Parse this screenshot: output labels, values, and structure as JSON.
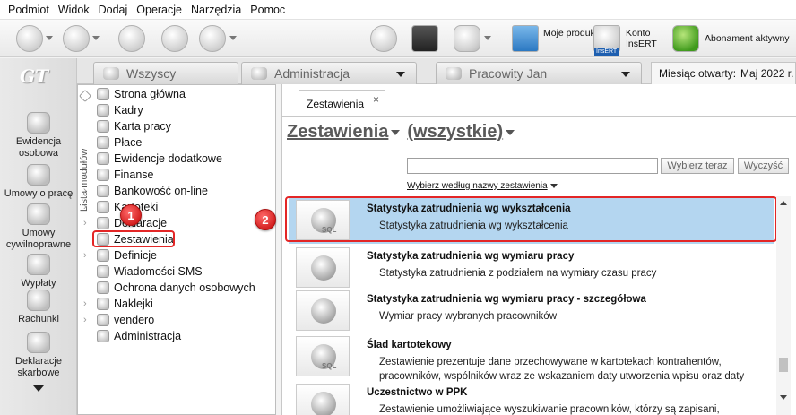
{
  "menu": [
    "Podmiot",
    "Widok",
    "Dodaj",
    "Operacje",
    "Narzędzia",
    "Pomoc"
  ],
  "toolbar": {
    "moje_produkty": "Moje produkty",
    "konto": "Konto InsERT",
    "abonament": "Abonament aktywny",
    "insert_badge": "InsERT"
  },
  "left_nav": {
    "logo": "GT",
    "items": [
      "Ewidencja osobowa",
      "Umowy o pracę",
      "Umowy cywilnoprawne",
      "Wypłaty",
      "Rachunki",
      "Deklaracje skarbowe"
    ]
  },
  "context_tabs": {
    "all": "Wszyscy",
    "department": "Administracja",
    "employee": "Pracowity Jan",
    "month_label": "Miesiąc otwarty:",
    "month_value": "Maj 2022 r."
  },
  "modules": {
    "title": "Lista modułów",
    "items": [
      "Strona główna",
      "Kadry",
      "Karta pracy",
      "Płace",
      "Ewidencje dodatkowe",
      "Finanse",
      "Bankowość on-line",
      "Kartoteki",
      "Deklaracje",
      "Zestawienia",
      "Definicje",
      "Wiadomości SMS",
      "Ochrona danych osobowych",
      "Naklejki",
      "vendero",
      "Administracja"
    ]
  },
  "annotations": [
    "1",
    "2"
  ],
  "document_tab": {
    "label": "Zestawienia",
    "close": "×"
  },
  "main": {
    "heading": "Zestawienia",
    "filter": "(wszystkie)",
    "search_value": "",
    "search_button": "Wybierz teraz",
    "clear_button": "Wyczyść",
    "pick_link": "Wybierz według nazwy zestawienia"
  },
  "reports": [
    {
      "title": "Statystyka zatrudnienia wg wykształcenia",
      "desc": "Statystyka zatrudnienia wg wykształcenia",
      "icon": "sql",
      "sql": "SQL"
    },
    {
      "title": "Statystyka zatrudnienia wg wymiaru pracy",
      "desc": "Statystyka zatrudnienia z podziałem na wymiary czasu pracy",
      "icon": "person"
    },
    {
      "title": "Statystyka zatrudnienia wg wymiaru pracy - szczegółowa",
      "desc": "Wymiar pracy wybranych pracowników",
      "icon": "person"
    },
    {
      "title": "Ślad kartotekowy",
      "desc": "Zestawienie prezentuje dane przechowywane w kartotekach kontrahentów, pracowników, wspólników wraz ze wskazaniem daty utworzenia wpisu oraz daty",
      "icon": "sql",
      "sql": "SQL"
    },
    {
      "title": "Uczestnictwo w PPK",
      "desc": "Zestawienie umożliwiające wyszukiwanie pracowników, którzy są zapisani,",
      "icon": "person"
    }
  ],
  "colors": {
    "highlight": "#e32626",
    "selected_row": "#b4d6f0"
  }
}
